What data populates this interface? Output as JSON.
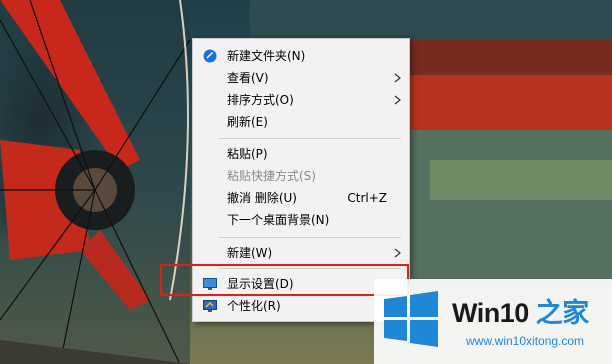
{
  "menu": {
    "items": [
      {
        "label": "新建文件夹(N)",
        "icon": "new-folder-icon"
      },
      {
        "label": "查看(V)",
        "submenu": true
      },
      {
        "label": "排序方式(O)",
        "submenu": true
      },
      {
        "label": "刷新(E)"
      },
      {
        "label": "粘贴(P)"
      },
      {
        "label": "粘贴快捷方式(S)",
        "disabled": true
      },
      {
        "label": "撤消 删除(U)",
        "shortcut": "Ctrl+Z"
      },
      {
        "label": "下一个桌面背景(N)"
      },
      {
        "label": "新建(W)",
        "submenu": true
      },
      {
        "label": "显示设置(D)",
        "icon": "display-settings-icon",
        "highlighted": true
      },
      {
        "label": "个性化(R)",
        "icon": "personalize-icon"
      }
    ]
  },
  "watermark": {
    "brand_main": "Win10",
    "brand_accent": " 之家",
    "url": "www.win10xitong.com"
  },
  "colors": {
    "highlight_border": "#e01e1e",
    "windows_blue": "#1e88d6",
    "menu_background": "#f2f2f2"
  }
}
